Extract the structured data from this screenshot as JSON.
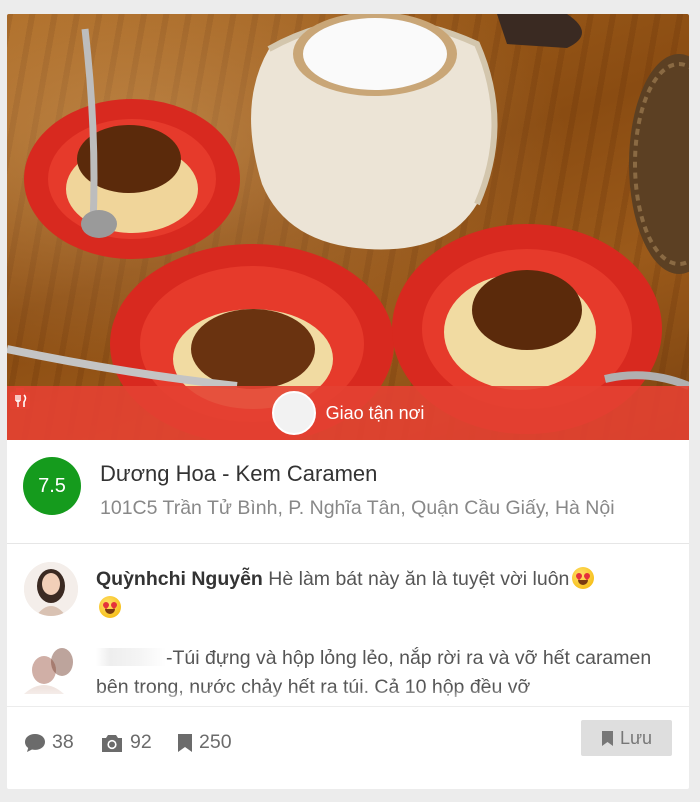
{
  "delivery": {
    "label": "Giao tận nơi",
    "icon": "delivery-utensils-icon"
  },
  "restaurant": {
    "score": "7.5",
    "name": "Dương Hoa - Kem Caramen",
    "address": "101C5 Trần Tử Bình, P. Nghĩa Tân, Quận Cầu Giấy, Hà Nội",
    "score_color": "#159b1d"
  },
  "reviews": [
    {
      "reviewer": "Quỳnhchi Nguyễn",
      "text": "Hè làm bát này ăn là tuyệt vời luôn",
      "emojis": [
        "heart-eyes-emoji",
        "smiling-hearts-emoji"
      ]
    },
    {
      "reviewer": "",
      "text": "-Túi đựng và hộp lỏng lẻo, nắp rời ra và vỡ hết caramen bên trong, nước chảy hết ra túi. Cả 10 hộp đều vỡ"
    }
  ],
  "stats": {
    "comments": "38",
    "photos": "92",
    "saves": "250"
  },
  "actions": {
    "save_label": "Lưu"
  },
  "colors": {
    "delivery_bar": "#e44132",
    "accent_red": "#e5323b"
  }
}
